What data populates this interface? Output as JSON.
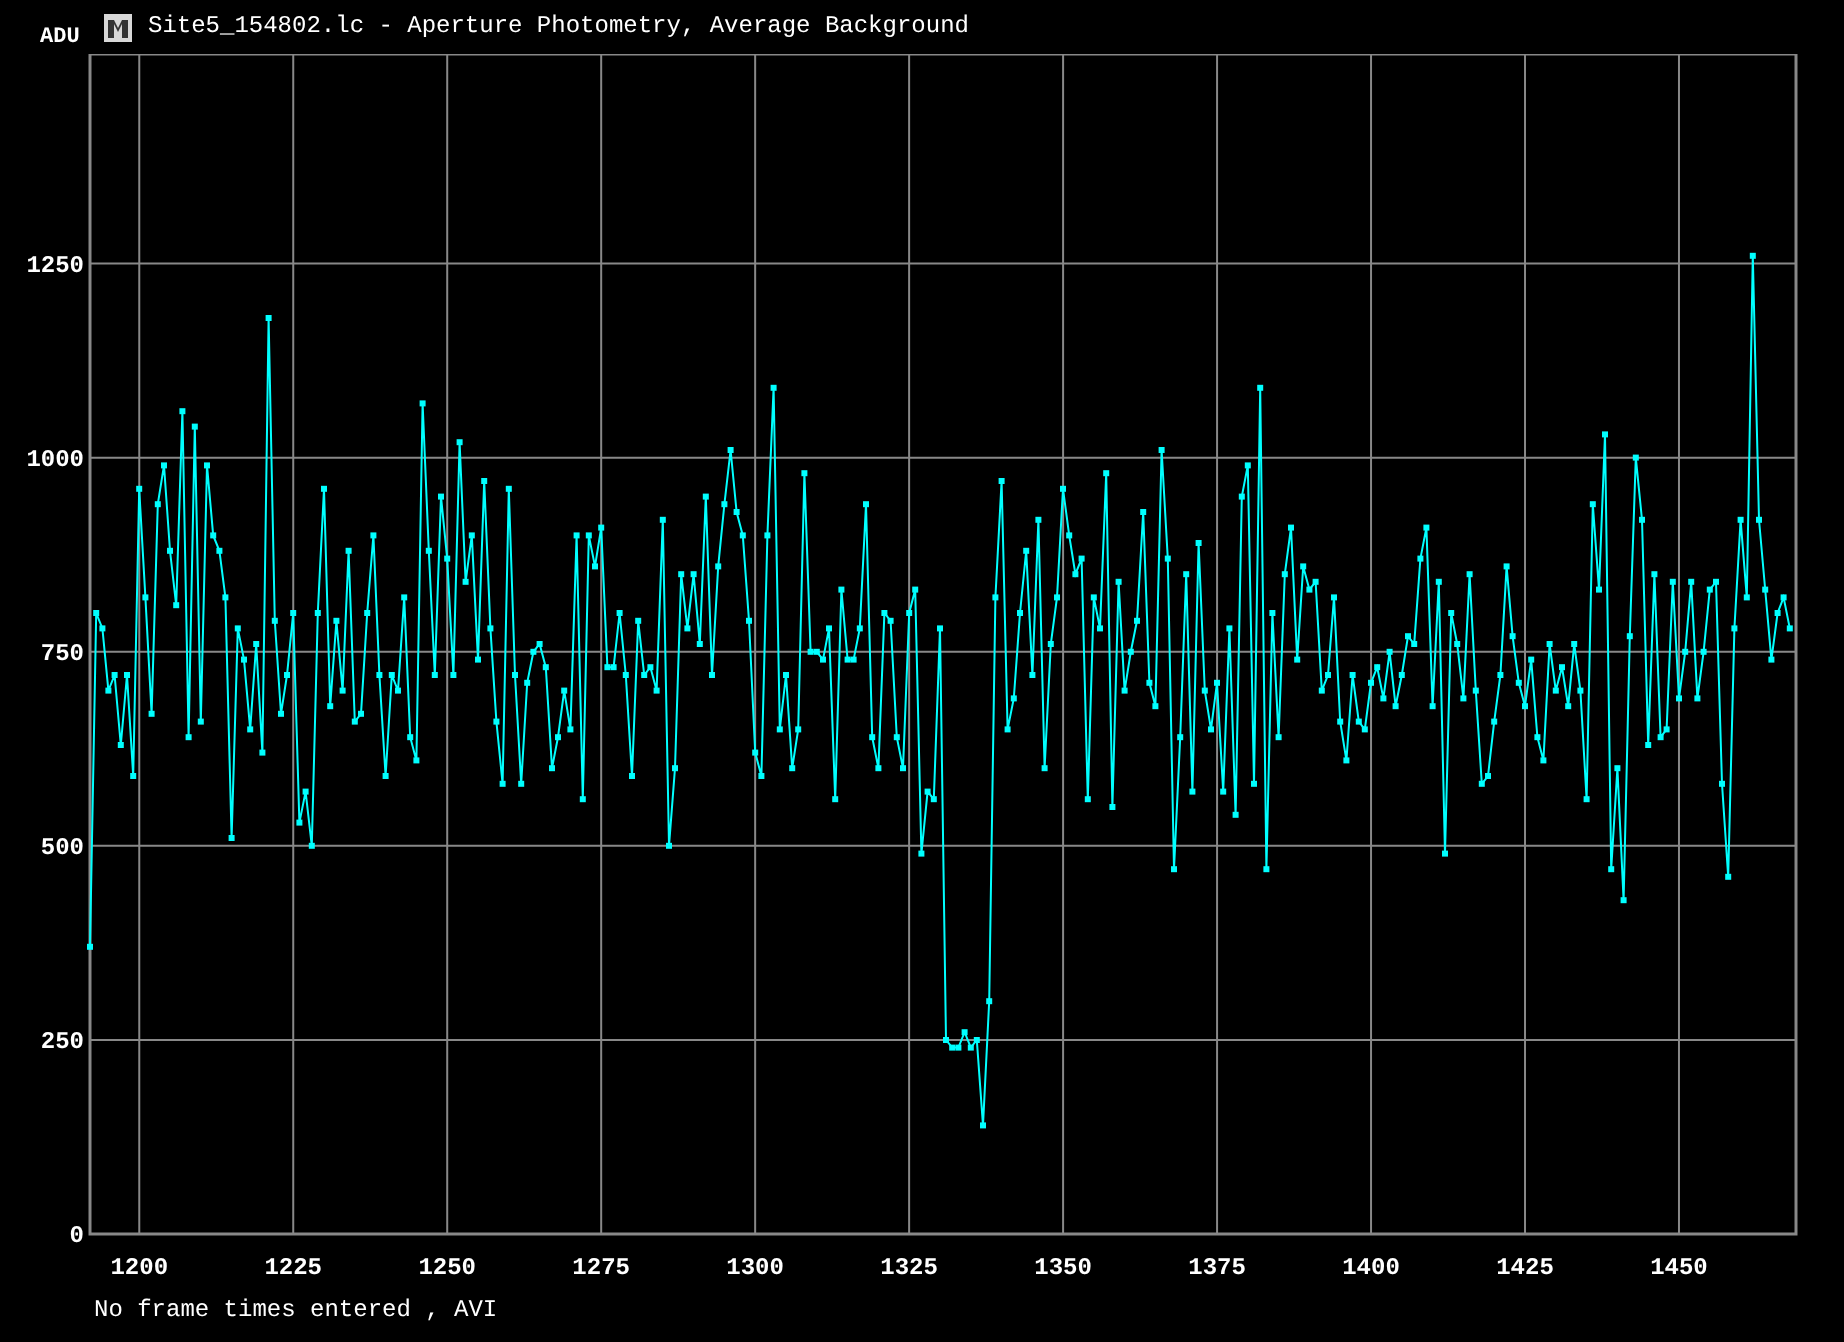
{
  "window": {
    "title": "Site5_154802.lc - Aperture Photometry, Average Background"
  },
  "plot": {
    "chart_data": {
      "type": "line",
      "ylabel": "ADU",
      "xlim": [
        1192,
        1469
      ],
      "ylim": [
        0,
        1520
      ],
      "xticks": [
        1200,
        1225,
        1250,
        1275,
        1300,
        1325,
        1350,
        1375,
        1400,
        1425,
        1450
      ],
      "yticks": [
        0,
        250,
        500,
        750,
        1000,
        1250
      ],
      "x": [
        1192,
        1193,
        1194,
        1195,
        1196,
        1197,
        1198,
        1199,
        1200,
        1201,
        1202,
        1203,
        1204,
        1205,
        1206,
        1207,
        1208,
        1209,
        1210,
        1211,
        1212,
        1213,
        1214,
        1215,
        1216,
        1217,
        1218,
        1219,
        1220,
        1221,
        1222,
        1223,
        1224,
        1225,
        1226,
        1227,
        1228,
        1229,
        1230,
        1231,
        1232,
        1233,
        1234,
        1235,
        1236,
        1237,
        1238,
        1239,
        1240,
        1241,
        1242,
        1243,
        1244,
        1245,
        1246,
        1247,
        1248,
        1249,
        1250,
        1251,
        1252,
        1253,
        1254,
        1255,
        1256,
        1257,
        1258,
        1259,
        1260,
        1261,
        1262,
        1263,
        1264,
        1265,
        1266,
        1267,
        1268,
        1269,
        1270,
        1271,
        1272,
        1273,
        1274,
        1275,
        1276,
        1277,
        1278,
        1279,
        1280,
        1281,
        1282,
        1283,
        1284,
        1285,
        1286,
        1287,
        1288,
        1289,
        1290,
        1291,
        1292,
        1293,
        1294,
        1295,
        1296,
        1297,
        1298,
        1299,
        1300,
        1301,
        1302,
        1303,
        1304,
        1305,
        1306,
        1307,
        1308,
        1309,
        1310,
        1311,
        1312,
        1313,
        1314,
        1315,
        1316,
        1317,
        1318,
        1319,
        1320,
        1321,
        1322,
        1323,
        1324,
        1325,
        1326,
        1327,
        1328,
        1329,
        1330,
        1331,
        1332,
        1333,
        1334,
        1335,
        1336,
        1337,
        1338,
        1339,
        1340,
        1341,
        1342,
        1343,
        1344,
        1345,
        1346,
        1347,
        1348,
        1349,
        1350,
        1351,
        1352,
        1353,
        1354,
        1355,
        1356,
        1357,
        1358,
        1359,
        1360,
        1361,
        1362,
        1363,
        1364,
        1365,
        1366,
        1367,
        1368,
        1369,
        1370,
        1371,
        1372,
        1373,
        1374,
        1375,
        1376,
        1377,
        1378,
        1379,
        1380,
        1381,
        1382,
        1383,
        1384,
        1385,
        1386,
        1387,
        1388,
        1389,
        1390,
        1391,
        1392,
        1393,
        1394,
        1395,
        1396,
        1397,
        1398,
        1399,
        1400,
        1401,
        1402,
        1403,
        1404,
        1405,
        1406,
        1407,
        1408,
        1409,
        1410,
        1411,
        1412,
        1413,
        1414,
        1415,
        1416,
        1417,
        1418,
        1419,
        1420,
        1421,
        1422,
        1423,
        1424,
        1425,
        1426,
        1427,
        1428,
        1429,
        1430,
        1431,
        1432,
        1433,
        1434,
        1435,
        1436,
        1437,
        1438,
        1439,
        1440,
        1441,
        1442,
        1443,
        1444,
        1445,
        1446,
        1447,
        1448,
        1449,
        1450,
        1451,
        1452,
        1453,
        1454,
        1455,
        1456,
        1457,
        1458,
        1459,
        1460,
        1461,
        1462,
        1463,
        1464,
        1465,
        1466,
        1467,
        1468
      ],
      "grid": true,
      "series": [
        {
          "color": "#00ffff",
          "values": [
            370,
            800,
            780,
            700,
            720,
            630,
            720,
            590,
            960,
            820,
            670,
            940,
            990,
            880,
            810,
            1060,
            640,
            1040,
            660,
            990,
            900,
            880,
            820,
            510,
            780,
            740,
            650,
            760,
            620,
            1180,
            790,
            670,
            720,
            800,
            530,
            570,
            500,
            800,
            960,
            680,
            790,
            700,
            880,
            660,
            670,
            800,
            900,
            720,
            590,
            720,
            700,
            820,
            640,
            610,
            1070,
            880,
            720,
            950,
            870,
            720,
            1020,
            840,
            900,
            740,
            970,
            780,
            660,
            580,
            960,
            720,
            580,
            710,
            750,
            760,
            730,
            600,
            640,
            700,
            650,
            900,
            560,
            900,
            860,
            910,
            730,
            730,
            800,
            720,
            590,
            790,
            720,
            730,
            700,
            920,
            500,
            600,
            850,
            780,
            850,
            760,
            950,
            720,
            860,
            940,
            1010,
            930,
            900,
            790,
            620,
            590,
            900,
            1090,
            650,
            720,
            600,
            650,
            980,
            750,
            750,
            740,
            780,
            560,
            830,
            740,
            740,
            780,
            940,
            640,
            600,
            800,
            790,
            640,
            600,
            800,
            830,
            490,
            570,
            560,
            780,
            250,
            240,
            240,
            260,
            240,
            250,
            140,
            300,
            820,
            970,
            650,
            690,
            800,
            880,
            720,
            920,
            600,
            760,
            820,
            960,
            900,
            850,
            870,
            560,
            820,
            780,
            980,
            550,
            840,
            700,
            750,
            790,
            930,
            710,
            680,
            1010,
            870,
            470,
            640,
            850,
            570,
            890,
            700,
            650,
            710,
            570,
            780,
            540,
            950,
            990,
            580,
            1090,
            470,
            800,
            640,
            850,
            910,
            740,
            860,
            830,
            840,
            700,
            720,
            820,
            660,
            610,
            720,
            660,
            650,
            710,
            730,
            690,
            750,
            680,
            720,
            770,
            760,
            870,
            910,
            680,
            840,
            490,
            800,
            760,
            690,
            850,
            700,
            580,
            590,
            660,
            720,
            860,
            770,
            710,
            680,
            740,
            640,
            610,
            760,
            700,
            730,
            680,
            760,
            700,
            560,
            940,
            830,
            1030,
            470,
            600,
            430,
            770,
            1000,
            920,
            630,
            850,
            640,
            650,
            840,
            690,
            750,
            840,
            690,
            750,
            830,
            840,
            580,
            460,
            780,
            920,
            820,
            1260,
            920,
            830,
            740,
            800,
            820,
            780
          ]
        }
      ]
    }
  },
  "status_bar": {
    "text": "No frame times entered , AVI"
  }
}
